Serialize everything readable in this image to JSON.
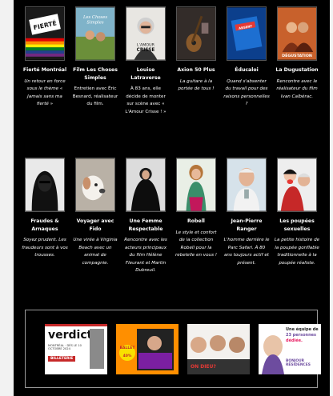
{
  "cards_row1": [
    {
      "title": "Fierté Montréal",
      "desc": "Un retour en force sous le thème « Jamais sans ma fierté »",
      "italic": true,
      "icon": "rainbow-poster-icon"
    },
    {
      "title": "Film Les Choses Simples",
      "desc": "Entretien avec Éric Besnard, réalisateur du film.",
      "italic": false,
      "icon": "movie-poster-icon"
    },
    {
      "title": "Louise Latraverse",
      "desc": "À 83 ans, elle décide de monter sur scène avec « L'Amour Crisse ! »",
      "italic": false,
      "icon": "portrait-icon"
    },
    {
      "title": "Axion 50 Plus",
      "desc": "La guitare à la portée de tous !",
      "italic": true,
      "icon": "guitar-icon"
    },
    {
      "title": "Éducaloi",
      "desc": "Quand s'absenter du travail pour des raisons personnelles ?",
      "italic": true,
      "icon": "book-icon"
    },
    {
      "title": "La Dugustation",
      "desc": "Rencontre avec le réalisateur du film Ivan Calbérac.",
      "italic": true,
      "icon": "movie-poster-icon"
    }
  ],
  "cards_row2": [
    {
      "title": "Fraudes & Arnaques",
      "desc": "Soyez prudent. Les fraudeurs sont à vos trousses.",
      "italic": true,
      "icon": "hooded-hacker-icon"
    },
    {
      "title": "Voyager avec Fido",
      "desc": "Une virée à Virginia Beach avec un animal de compagnie.",
      "italic": true,
      "icon": "dog-icon"
    },
    {
      "title": "Une Femme Respectable",
      "desc": "Rencontre avec les acteurs principaux du film Hélène Fleurant et Martin Dubreuil.",
      "italic": true,
      "icon": "woman-in-black-icon"
    },
    {
      "title": "Robell",
      "desc": "Le style et confort de la collection Robell pour la rebelelle en vous !",
      "italic": true,
      "icon": "fashion-model-icon"
    },
    {
      "title": "Jean-Pierre Ranger",
      "desc": "L'homme derrière le Parc Safari. À 80 ans toujours actif et présent.",
      "italic": true,
      "icon": "man-portrait-icon"
    },
    {
      "title": "Les poupées sexuelles",
      "desc": "La petite histoire de la poupée gonflable traditionnelle à la poupée réaliste.",
      "italic": true,
      "icon": "doll-icon"
    }
  ],
  "ads": {
    "verdict": {
      "title": "verdict",
      "line1": "MONTRÉAL · DÈS LE 10 OCTOBRE 2024",
      "button": "BILLETERIE",
      "icon": "theatre-ad-icon"
    },
    "magazine": {
      "badge": "BALLET 40%",
      "icon": "magazine-ad-icon"
    },
    "play": {
      "caption": "ON DIEU?",
      "icon": "theatre-play-ad-icon"
    },
    "residences": {
      "line1": "Une équipe de",
      "line2": "23 personnes",
      "line3": "dédiée.",
      "brand": "BONJOUR RÉSIDENCES",
      "icon": "residence-ad-icon"
    }
  },
  "colors": {
    "background": "#000000",
    "text": "#ffffff",
    "page": "#f2f2f2"
  }
}
